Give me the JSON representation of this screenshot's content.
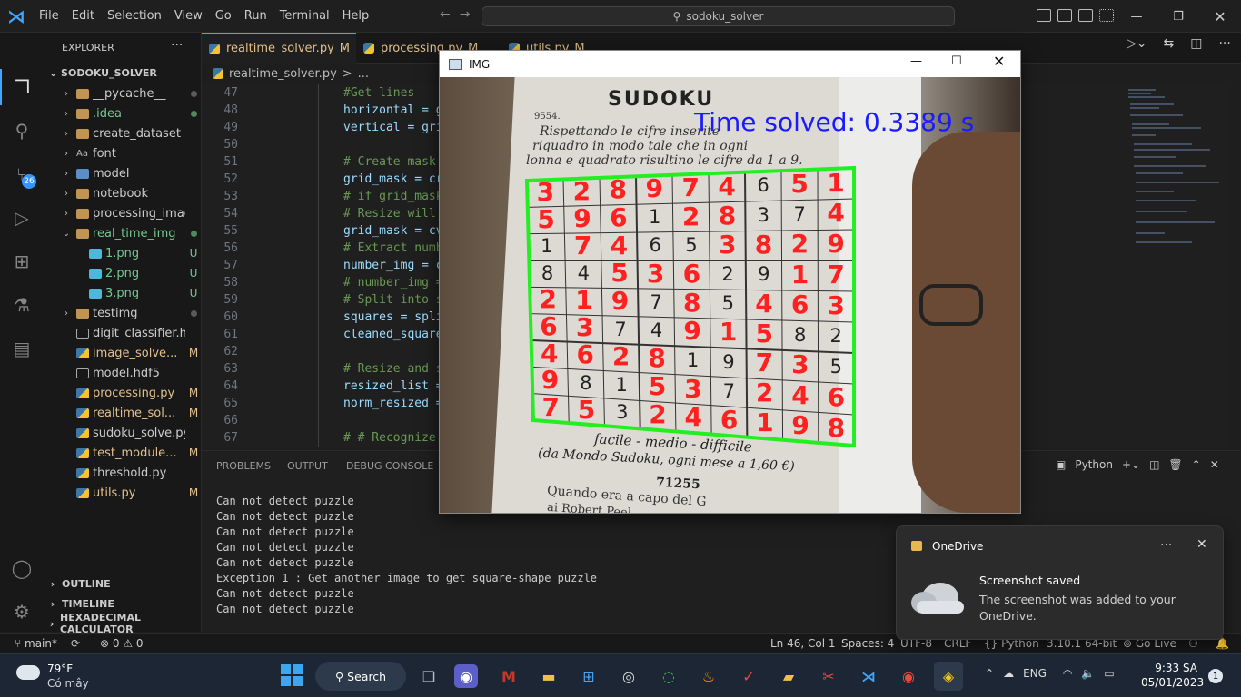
{
  "titlebar": {
    "menu": [
      "File",
      "Edit",
      "Selection",
      "View",
      "Go",
      "Run",
      "Terminal",
      "Help"
    ],
    "search_text": "sodoku_solver"
  },
  "activity": {
    "source_control_badge": "26"
  },
  "sidebar": {
    "title": "EXPLORER",
    "more": "···",
    "project": "SODOKU_SOLVER",
    "items": [
      {
        "label": "__pycache__",
        "kind": "folder",
        "status": "dot"
      },
      {
        "label": ".idea",
        "kind": "folder",
        "status": "dot-green"
      },
      {
        "label": "create_dataset",
        "kind": "folder",
        "status": ""
      },
      {
        "label": "font",
        "kind": "folder-font",
        "status": ""
      },
      {
        "label": "model",
        "kind": "folder-blue",
        "status": ""
      },
      {
        "label": "notebook",
        "kind": "folder",
        "status": ""
      },
      {
        "label": "processing_image",
        "kind": "folder",
        "status": ""
      },
      {
        "label": "real_time_img",
        "kind": "folder-open",
        "status": "dot-green"
      },
      {
        "label": "1.png",
        "kind": "png",
        "status": "U"
      },
      {
        "label": "2.png",
        "kind": "png",
        "status": "U"
      },
      {
        "label": "3.png",
        "kind": "png",
        "status": "U"
      },
      {
        "label": "testimg",
        "kind": "folder",
        "status": "dot"
      },
      {
        "label": "digit_classifier.h5",
        "kind": "file",
        "status": ""
      },
      {
        "label": "image_solve...",
        "kind": "py",
        "status": "M"
      },
      {
        "label": "model.hdf5",
        "kind": "file",
        "status": ""
      },
      {
        "label": "processing.py",
        "kind": "py",
        "status": "M"
      },
      {
        "label": "realtime_sol...",
        "kind": "py",
        "status": "M"
      },
      {
        "label": "sudoku_solve.py",
        "kind": "py",
        "status": ""
      },
      {
        "label": "test_module...",
        "kind": "py",
        "status": "M"
      },
      {
        "label": "threshold.py",
        "kind": "py",
        "status": ""
      },
      {
        "label": "utils.py",
        "kind": "py",
        "status": "M"
      }
    ],
    "sections": [
      "OUTLINE",
      "TIMELINE",
      "HEXADECIMAL CALCULATOR"
    ]
  },
  "tabs": [
    {
      "label": "realtime_solver.py",
      "status": "M"
    },
    {
      "label": "processing.py",
      "status": "M"
    },
    {
      "label": "utils.py",
      "status": "M"
    }
  ],
  "breadcrumb": {
    "file": "realtime_solver.py",
    "sep": ">",
    "more": "..."
  },
  "code": {
    "lines": [
      {
        "n": "47",
        "text": "#Get lines",
        "type": "cmt"
      },
      {
        "n": "48",
        "text": "horizontal = g",
        "type": "var"
      },
      {
        "n": "49",
        "text": "vertical = gri",
        "type": "var"
      },
      {
        "n": "50",
        "text": "",
        "type": "var"
      },
      {
        "n": "51",
        "text": "# Create mask",
        "type": "cmt"
      },
      {
        "n": "52",
        "text": "grid_mask = cr",
        "type": "var"
      },
      {
        "n": "53",
        "text": "# if grid_mask",
        "type": "cmt"
      },
      {
        "n": "54",
        "text": "# Resize will",
        "type": "cmt"
      },
      {
        "n": "55",
        "text": "grid_mask = cv",
        "type": "var"
      },
      {
        "n": "56",
        "text": "# Extract numb",
        "type": "cmt"
      },
      {
        "n": "57",
        "text": "number_img = c",
        "type": "var"
      },
      {
        "n": "58",
        "text": "# number_img =",
        "type": "cmt"
      },
      {
        "n": "59",
        "text": "# Split into s",
        "type": "cmt"
      },
      {
        "n": "60",
        "text": "squares = spli",
        "type": "var"
      },
      {
        "n": "61",
        "text": "cleaned_square",
        "type": "var"
      },
      {
        "n": "62",
        "text": "",
        "type": "var"
      },
      {
        "n": "63",
        "text": "# Resize and s",
        "type": "cmt"
      },
      {
        "n": "64",
        "text": "resized_list =",
        "type": "var"
      },
      {
        "n": "65",
        "text": "norm_resized =",
        "type": "var"
      },
      {
        "n": "66",
        "text": "",
        "type": "var"
      },
      {
        "n": "67",
        "text": "# # Recognize",
        "type": "cmt"
      }
    ]
  },
  "panel": {
    "tabs": [
      "PROBLEMS",
      "OUTPUT",
      "DEBUG CONSOLE"
    ],
    "terminal_name": "Python",
    "output": [
      "Can not detect puzzle",
      "Can not detect puzzle",
      "Can not detect puzzle",
      "Can not detect puzzle",
      "Can not detect puzzle",
      "Exception 1 : Get another image to get square-shape puzzle",
      "Can not detect puzzle",
      "Can not detect puzzle"
    ]
  },
  "statusbar": {
    "branch": "main*",
    "errors": "0",
    "warnings": "0",
    "position": "Ln 46, Col 1",
    "spaces": "Spaces: 4",
    "encoding": "UTF-8",
    "eol": "CRLF",
    "language": "Python",
    "interpreter": "3.10.1 64-bit",
    "golive": "Go Live"
  },
  "imgwin": {
    "title": "IMG",
    "time_text": "Time solved: 0.3389 s",
    "page_title": "SUDOKU",
    "page_number": "9554.",
    "page_text1": "Rispettando le cifre inserite",
    "page_text2": "riquadro in modo tale che in ogni",
    "page_text3": "lonna e quadrato risultino le cifre da 1 a 9.",
    "foot1": "facile - medio - difficile",
    "foot2": "(da Mondo Sudoku, ogni mese a 1,60 €)",
    "foot3": "71255",
    "foot4": "Quando era a capo del G",
    "foot5": "ai Robert Peel",
    "grid": [
      [
        {
          "v": "3",
          "s": 1
        },
        {
          "v": "2",
          "s": 1
        },
        {
          "v": "8",
          "s": 1
        },
        {
          "v": "9",
          "s": 1
        },
        {
          "v": "7",
          "s": 1
        },
        {
          "v": "4",
          "s": 1
        },
        {
          "v": "6",
          "s": 0
        },
        {
          "v": "5",
          "s": 1
        },
        {
          "v": "1",
          "s": 1
        }
      ],
      [
        {
          "v": "5",
          "s": 1
        },
        {
          "v": "9",
          "s": 1
        },
        {
          "v": "6",
          "s": 1
        },
        {
          "v": "1",
          "s": 0
        },
        {
          "v": "2",
          "s": 1
        },
        {
          "v": "8",
          "s": 1
        },
        {
          "v": "3",
          "s": 0
        },
        {
          "v": "7",
          "s": 0
        },
        {
          "v": "4",
          "s": 1
        }
      ],
      [
        {
          "v": "1",
          "s": 0
        },
        {
          "v": "7",
          "s": 1
        },
        {
          "v": "4",
          "s": 1
        },
        {
          "v": "6",
          "s": 0
        },
        {
          "v": "5",
          "s": 0
        },
        {
          "v": "3",
          "s": 1
        },
        {
          "v": "8",
          "s": 1
        },
        {
          "v": "2",
          "s": 1
        },
        {
          "v": "9",
          "s": 1
        }
      ],
      [
        {
          "v": "8",
          "s": 0
        },
        {
          "v": "4",
          "s": 0
        },
        {
          "v": "5",
          "s": 1
        },
        {
          "v": "3",
          "s": 1
        },
        {
          "v": "6",
          "s": 1
        },
        {
          "v": "2",
          "s": 0
        },
        {
          "v": "9",
          "s": 0
        },
        {
          "v": "1",
          "s": 1
        },
        {
          "v": "7",
          "s": 1
        }
      ],
      [
        {
          "v": "2",
          "s": 1
        },
        {
          "v": "1",
          "s": 1
        },
        {
          "v": "9",
          "s": 1
        },
        {
          "v": "7",
          "s": 0
        },
        {
          "v": "8",
          "s": 1
        },
        {
          "v": "5",
          "s": 0
        },
        {
          "v": "4",
          "s": 1
        },
        {
          "v": "6",
          "s": 1
        },
        {
          "v": "3",
          "s": 1
        }
      ],
      [
        {
          "v": "6",
          "s": 1
        },
        {
          "v": "3",
          "s": 1
        },
        {
          "v": "7",
          "s": 0
        },
        {
          "v": "4",
          "s": 0
        },
        {
          "v": "9",
          "s": 1
        },
        {
          "v": "1",
          "s": 1
        },
        {
          "v": "5",
          "s": 1
        },
        {
          "v": "8",
          "s": 0
        },
        {
          "v": "2",
          "s": 0
        }
      ],
      [
        {
          "v": "4",
          "s": 1
        },
        {
          "v": "6",
          "s": 1
        },
        {
          "v": "2",
          "s": 1
        },
        {
          "v": "8",
          "s": 1
        },
        {
          "v": "1",
          "s": 0
        },
        {
          "v": "9",
          "s": 0
        },
        {
          "v": "7",
          "s": 1
        },
        {
          "v": "3",
          "s": 1
        },
        {
          "v": "5",
          "s": 0
        }
      ],
      [
        {
          "v": "9",
          "s": 1
        },
        {
          "v": "8",
          "s": 0
        },
        {
          "v": "1",
          "s": 0
        },
        {
          "v": "5",
          "s": 1
        },
        {
          "v": "3",
          "s": 1
        },
        {
          "v": "7",
          "s": 0
        },
        {
          "v": "2",
          "s": 1
        },
        {
          "v": "4",
          "s": 1
        },
        {
          "v": "6",
          "s": 1
        }
      ],
      [
        {
          "v": "7",
          "s": 1
        },
        {
          "v": "5",
          "s": 1
        },
        {
          "v": "3",
          "s": 0
        },
        {
          "v": "2",
          "s": 1
        },
        {
          "v": "4",
          "s": 1
        },
        {
          "v": "6",
          "s": 1
        },
        {
          "v": "1",
          "s": 1
        },
        {
          "v": "9",
          "s": 1
        },
        {
          "v": "8",
          "s": 1
        }
      ]
    ]
  },
  "toast": {
    "app": "OneDrive",
    "more": "···",
    "title": "Screenshot saved",
    "body": "The screenshot was added to your OneDrive."
  },
  "taskbar": {
    "temp": "79°F",
    "weather": "Có mây",
    "search": "Search",
    "lang": "ENG",
    "time": "9:33 SA",
    "date": "05/01/2023",
    "notif": "1"
  },
  "colors": {
    "accent": "#3ea6ff",
    "solved": "#ff2020",
    "grid_border": "#22ee22",
    "time_text": "#1a1aff"
  }
}
